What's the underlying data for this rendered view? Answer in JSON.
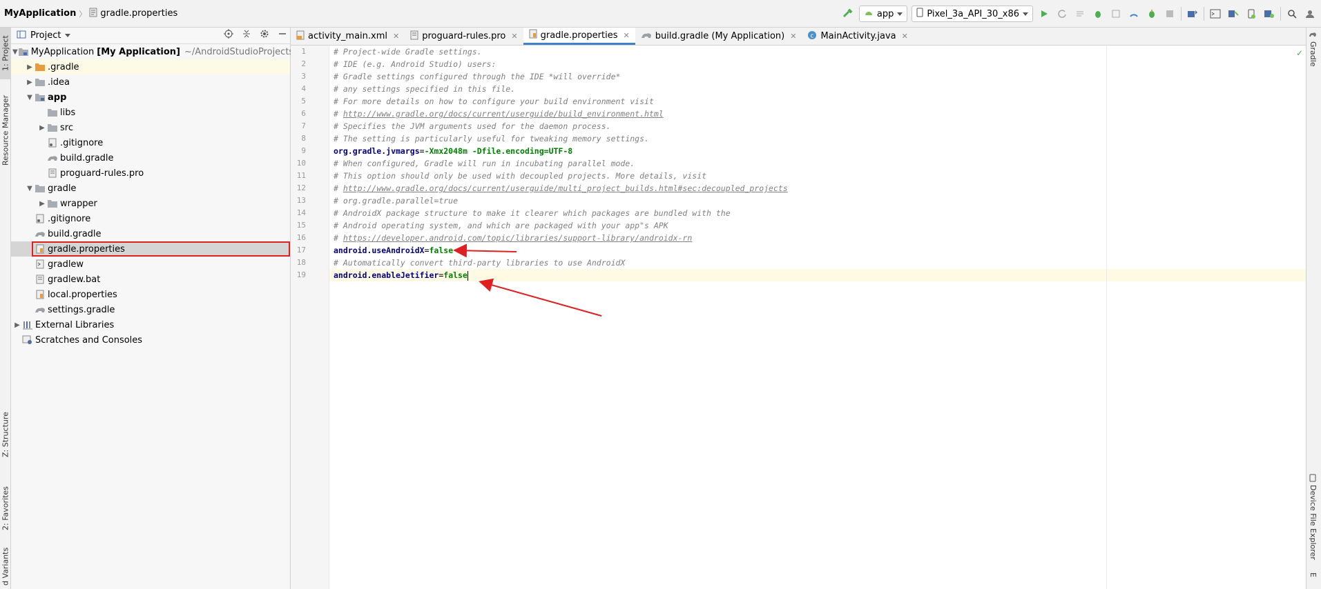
{
  "breadcrumb": {
    "project": "MyApplication",
    "file": "gradle.properties"
  },
  "toolbar": {
    "run_config": "app",
    "device": "Pixel_3a_API_30_x86"
  },
  "left_strip": {
    "project_tab": "1: Project",
    "resource_tab": "Resource Manager",
    "structure_tab": "Z: Structure",
    "favorites_tab": "2: Favorites",
    "variants_tab": "d Variants"
  },
  "right_strip": {
    "gradle_tab": "Gradle",
    "device_explorer_tab": "Device File Explorer",
    "bottom_tab": "E"
  },
  "project_panel": {
    "title": "Project",
    "tree": [
      {
        "label": "MyApplication",
        "bold_suffix": "[My Application]",
        "path": "~/AndroidStudioProjects/My"
      },
      {
        "label": ".gradle"
      },
      {
        "label": ".idea"
      },
      {
        "label": "app"
      },
      {
        "label": "libs"
      },
      {
        "label": "src"
      },
      {
        "label": ".gitignore"
      },
      {
        "label": "build.gradle"
      },
      {
        "label": "proguard-rules.pro"
      },
      {
        "label": "gradle"
      },
      {
        "label": "wrapper"
      },
      {
        "label": ".gitignore"
      },
      {
        "label": "build.gradle"
      },
      {
        "label": "gradle.properties"
      },
      {
        "label": "gradlew"
      },
      {
        "label": "gradlew.bat"
      },
      {
        "label": "local.properties"
      },
      {
        "label": "settings.gradle"
      },
      {
        "label": "External Libraries"
      },
      {
        "label": "Scratches and Consoles"
      }
    ]
  },
  "tabs": [
    {
      "label": "activity_main.xml"
    },
    {
      "label": "proguard-rules.pro"
    },
    {
      "label": "gradle.properties"
    },
    {
      "label": "build.gradle (My Application)"
    },
    {
      "label": "MainActivity.java"
    }
  ],
  "editor": {
    "lines": [
      {
        "n": "1",
        "text": "# Project-wide Gradle settings."
      },
      {
        "n": "2",
        "text": "# IDE (e.g. Android Studio) users:"
      },
      {
        "n": "3",
        "text": "# Gradle settings configured through the IDE *will override*"
      },
      {
        "n": "4",
        "text": "# any settings specified in this file."
      },
      {
        "n": "5",
        "text": "# For more details on how to configure your build environment visit"
      },
      {
        "n": "6",
        "prefix": "# ",
        "link": "http://www.gradle.org/docs/current/userguide/build_environment.html"
      },
      {
        "n": "7",
        "text": "# Specifies the JVM arguments used for the daemon process."
      },
      {
        "n": "8",
        "text": "# The setting is particularly useful for tweaking memory settings."
      },
      {
        "n": "9",
        "key": "org.gradle.jvmargs",
        "value": "-Xmx2048m -Dfile.encoding=UTF-8"
      },
      {
        "n": "10",
        "text": "# When configured, Gradle will run in incubating parallel mode."
      },
      {
        "n": "11",
        "text": "# This option should only be used with decoupled projects. More details, visit"
      },
      {
        "n": "12",
        "prefix": "# ",
        "link": "http://www.gradle.org/docs/current/userguide/multi_project_builds.html#sec:decoupled_projects"
      },
      {
        "n": "13",
        "text": "# org.gradle.parallel=true"
      },
      {
        "n": "14",
        "text": "# AndroidX package structure to make it clearer which packages are bundled with the"
      },
      {
        "n": "15",
        "text": "# Android operating system, and which are packaged with your app\"s APK"
      },
      {
        "n": "16",
        "prefix": "# ",
        "link": "https://developer.android.com/topic/libraries/support-library/androidx-rn"
      },
      {
        "n": "17",
        "key": "android.useAndroidX",
        "value": "false"
      },
      {
        "n": "18",
        "text": "# Automatically convert third-party libraries to use AndroidX"
      },
      {
        "n": "19",
        "key": "android.enableJetifier",
        "value": "false"
      }
    ]
  },
  "colors": {
    "accent": "#4083c9",
    "annotation": "#e02020"
  }
}
